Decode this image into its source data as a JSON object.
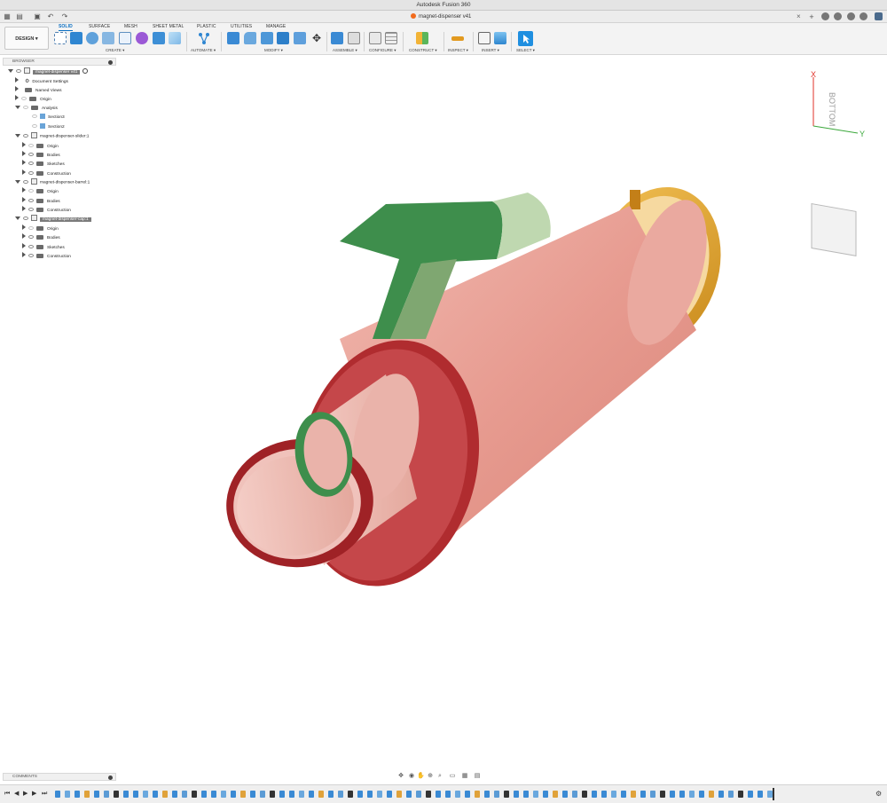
{
  "app": {
    "title": "Autodesk Fusion 360",
    "document_tab": "magnet-dispenser v41"
  },
  "toolbar": {
    "workspace": "DESIGN ▾",
    "tabs": [
      "SOLID",
      "SURFACE",
      "MESH",
      "SHEET METAL",
      "PLASTIC",
      "UTILITIES",
      "MANAGE"
    ],
    "active_tab": "SOLID",
    "groups": [
      "CREATE ▾",
      "AUTOMATE ▾",
      "MODIFY ▾",
      "ASSEMBLE ▾",
      "CONFIGURE ▾",
      "CONSTRUCT ▾",
      "INSPECT ▾",
      "INSERT ▾",
      "SELECT ▾"
    ],
    "accent": "#0b6fc2"
  },
  "browser": {
    "title": "BROWSER",
    "root": "magnet-dispenser v41",
    "items": [
      {
        "label": "Document Settings",
        "icon": "gear-icon"
      },
      {
        "label": "Named Views",
        "icon": "folder-icon"
      },
      {
        "label": "Origin",
        "icon": "folder-icon"
      },
      {
        "label": "Analysis",
        "icon": "folder-icon"
      },
      {
        "label": "Section3",
        "icon": "section-icon"
      },
      {
        "label": "Section2",
        "icon": "section-icon"
      },
      {
        "label": "magnet-dispenser-slider:1",
        "icon": "component-icon"
      },
      {
        "label": "Origin",
        "icon": "folder-icon"
      },
      {
        "label": "Bodies",
        "icon": "folder-icon"
      },
      {
        "label": "Sketches",
        "icon": "folder-icon"
      },
      {
        "label": "Construction",
        "icon": "folder-icon"
      },
      {
        "label": "magnet-dispenser-barrel:1",
        "icon": "component-icon"
      },
      {
        "label": "Origin",
        "icon": "folder-icon"
      },
      {
        "label": "Bodies",
        "icon": "folder-icon"
      },
      {
        "label": "Construction",
        "icon": "folder-icon"
      },
      {
        "label": "magnet-dispenser-cap:1",
        "icon": "component-icon"
      },
      {
        "label": "Origin",
        "icon": "folder-icon"
      },
      {
        "label": "Bodies",
        "icon": "folder-icon"
      },
      {
        "label": "Sketches",
        "icon": "folder-icon"
      },
      {
        "label": "Construction",
        "icon": "folder-icon"
      }
    ]
  },
  "viewcube": {
    "face": "BOTTOM",
    "axis_x": "X",
    "axis_y": "Y",
    "x_color": "#e0322a",
    "y_color": "#3ca83c"
  },
  "comments": {
    "title": "COMMENTS"
  },
  "colors": {
    "barrel": "#e8a39a",
    "barrel_rim": "#a5262a",
    "slider": "#3e8e4c",
    "cap": "#e2a62e"
  }
}
